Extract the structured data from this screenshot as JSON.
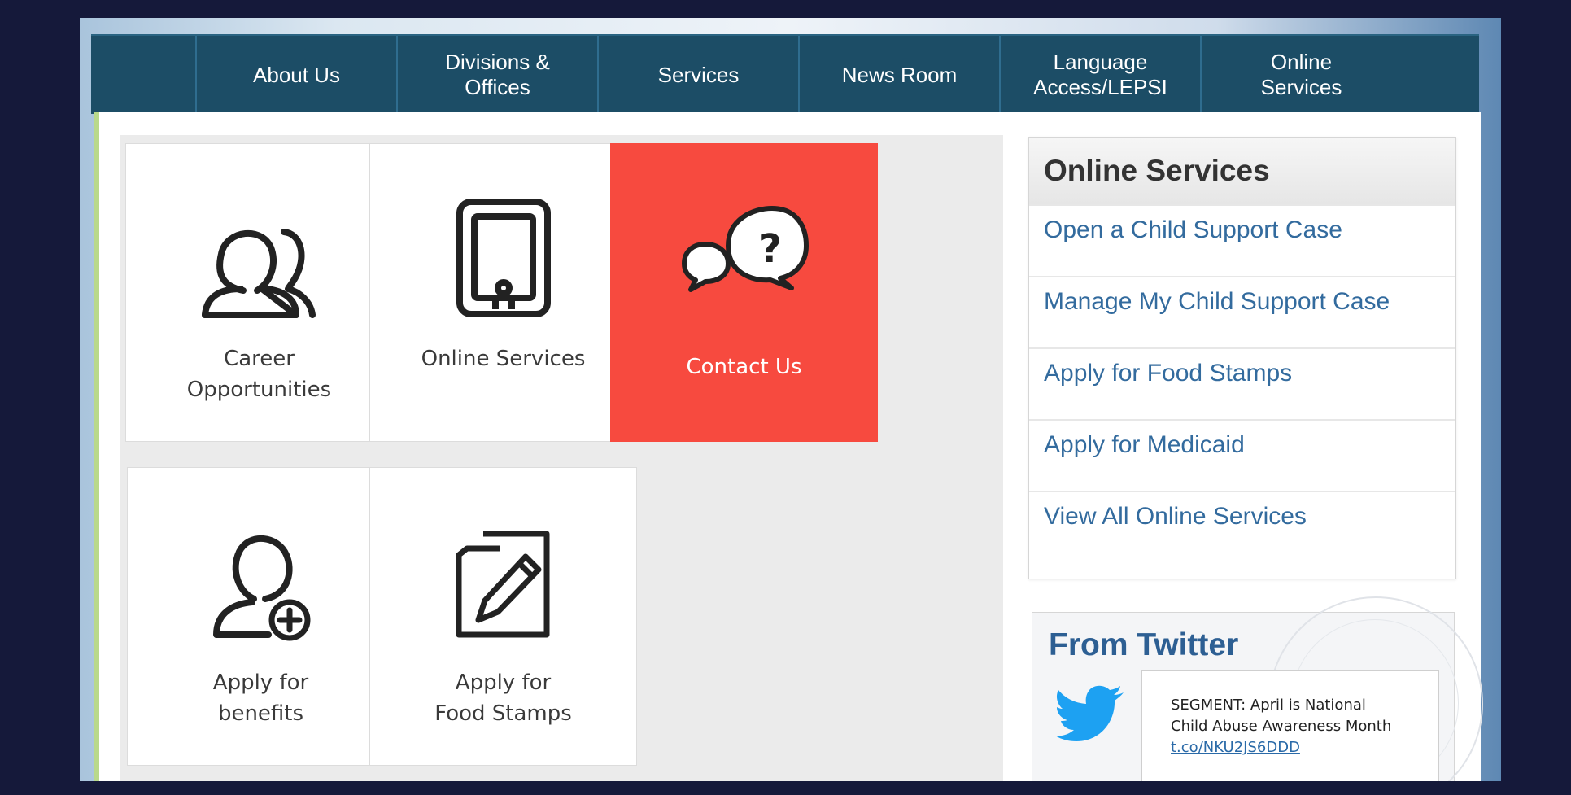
{
  "nav": {
    "items": [
      {
        "label": "About Us"
      },
      {
        "label": "Divisions &\nOffices"
      },
      {
        "label": "Services"
      },
      {
        "label": "News Room"
      },
      {
        "label": "Language\nAccess/LEPSI"
      },
      {
        "label": "Online\nServices"
      }
    ]
  },
  "tiles": [
    {
      "label": "Career\nOpportunities",
      "icon": "people-icon"
    },
    {
      "label": "Online Services",
      "icon": "tablet-icon"
    },
    {
      "label": "Contact Us",
      "icon": "question-bubble-icon"
    },
    {
      "label": "Apply for\nbenefits",
      "icon": "add-user-icon"
    },
    {
      "label": "Apply for\nFood Stamps",
      "icon": "document-pen-icon"
    }
  ],
  "sidebar": {
    "title": "Online Services",
    "links": [
      "Open a Child Support Case",
      "Manage My Child Support Case",
      "Apply for Food Stamps",
      "Apply for Medicaid",
      "View All Online Services"
    ]
  },
  "twitter": {
    "title": "From Twitter",
    "tweet_line1": "SEGMENT: April is National",
    "tweet_line2": "Child Abuse Awareness Month",
    "tweet_link": "t.co/NKU2JS6DDD",
    "icon": "twitter-bird-icon"
  },
  "colors": {
    "nav_bg": "#1c4d66",
    "contact_tile": "#f74a3f",
    "link": "#336b9e",
    "twitter_blue": "#1da1f2"
  }
}
